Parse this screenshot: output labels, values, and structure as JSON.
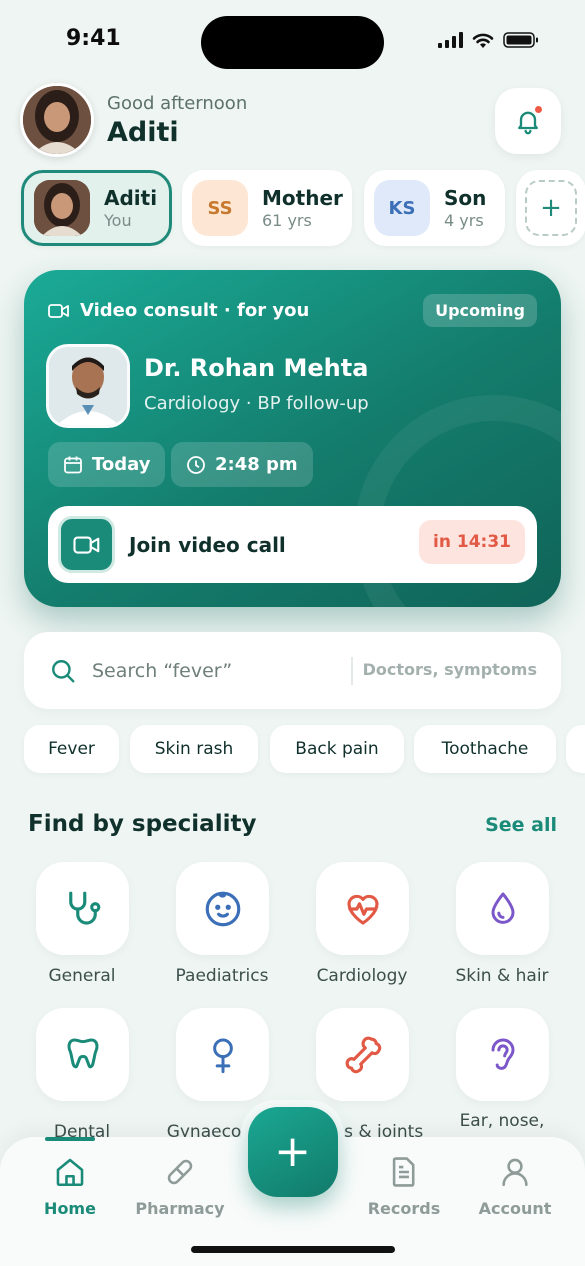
{
  "status": {
    "time": "9:41"
  },
  "header": {
    "greeting": "Good afternoon",
    "name": "Aditi"
  },
  "profiles": [
    {
      "name": "Aditi",
      "sub": "You",
      "active": true
    },
    {
      "initials": "SS",
      "name": "Mother",
      "sub": "61 yrs"
    },
    {
      "initials": "KS",
      "name": "Son",
      "sub": "4 yrs"
    }
  ],
  "add_profile": "+",
  "consult": {
    "type": "Video consult · for you",
    "badge": "Upcoming",
    "doctor": "Dr. Rohan Mehta",
    "specialty": "Cardiology · BP follow-up",
    "date": "Today",
    "time": "2:48 pm",
    "join_label": "Join video call",
    "countdown": "in 14:31"
  },
  "search": {
    "placeholder": "Search “fever”",
    "hint": "Doctors, symptoms"
  },
  "symptoms": [
    "Fever",
    "Skin rash",
    "Back pain",
    "Toothache"
  ],
  "speciality": {
    "title": "Find by speciality",
    "see_all": "See all",
    "items": [
      {
        "label": "General",
        "icon": "stethoscope-icon"
      },
      {
        "label": "Paediatrics",
        "icon": "baby-face-icon"
      },
      {
        "label": "Cardiology",
        "icon": "heart-pulse-icon"
      },
      {
        "label": "Skin & hair",
        "icon": "droplet-icon"
      },
      {
        "label": "Dental",
        "icon": "tooth-icon"
      },
      {
        "label": "Gynaecology",
        "icon": "female-icon"
      },
      {
        "label": "Bones & joints",
        "icon": "bone-icon"
      },
      {
        "label": "Ear, nose,",
        "icon": "ear-icon"
      }
    ]
  },
  "tabs": [
    {
      "label": "Home",
      "active": true
    },
    {
      "label": "Pharmacy"
    },
    {
      "label": "Records"
    },
    {
      "label": "Account"
    }
  ],
  "fab": "+",
  "colors": {
    "accent": "#1a8a79",
    "alert": "#ef5a45",
    "background": "#eef5f2"
  }
}
